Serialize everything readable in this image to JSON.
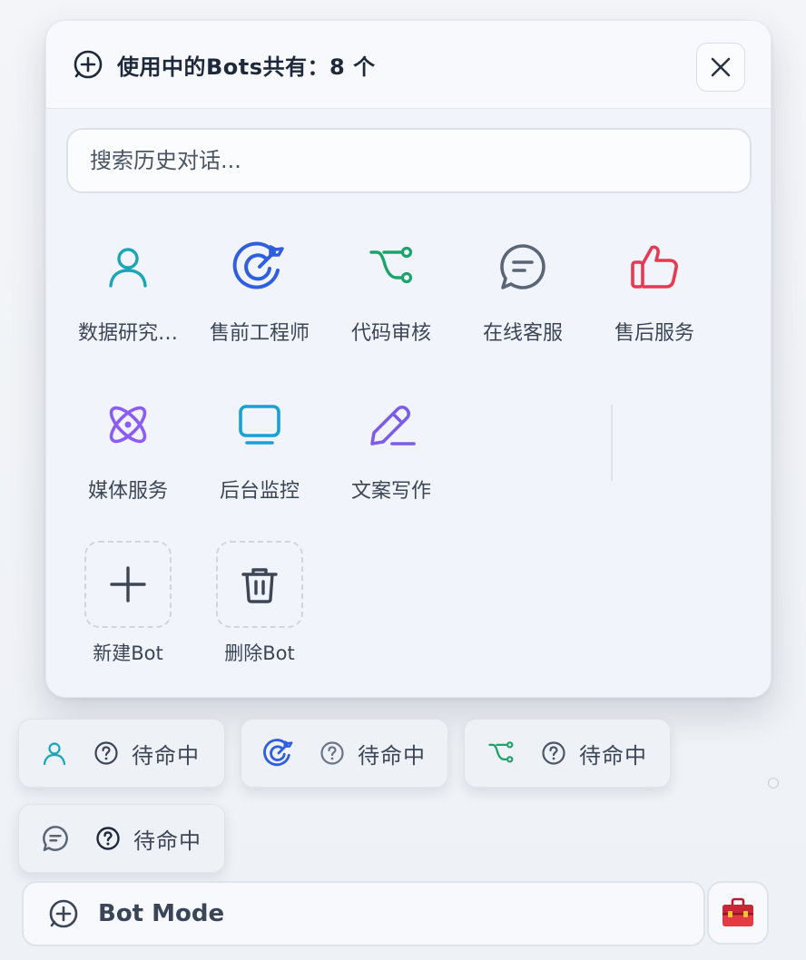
{
  "modal": {
    "title": "使用中的Bots共有：8 个",
    "search_placeholder": "搜索历史对话..."
  },
  "bots": [
    {
      "label": "数据研究…",
      "icon": "user-icon",
      "color": "#1aa6b7"
    },
    {
      "label": "售前工程师",
      "icon": "target-arrow-icon",
      "color": "#2f5fe0"
    },
    {
      "label": "代码审核",
      "icon": "branch-icon",
      "color": "#1ea36b"
    },
    {
      "label": "在线客服",
      "icon": "chat-bubble-icon",
      "color": "#5a6576"
    },
    {
      "label": "售后服务",
      "icon": "thumbs-up-icon",
      "color": "#e63a52"
    },
    {
      "label": "媒体服务",
      "icon": "atom-icon",
      "color": "#8b5cf6"
    },
    {
      "label": "后台监控",
      "icon": "monitor-icon",
      "color": "#1aa0d8"
    },
    {
      "label": "文案写作",
      "icon": "pencil-icon",
      "color": "#7c5ce8"
    }
  ],
  "actions": {
    "new_bot": "新建Bot",
    "delete_bot": "删除Bot"
  },
  "status_chips": [
    {
      "icon": "user-icon",
      "status": "待命中"
    },
    {
      "icon": "target-arrow-icon",
      "status": "待命中"
    },
    {
      "icon": "branch-icon",
      "status": "待命中"
    },
    {
      "icon": "chat-bubble-icon",
      "status": "待命中"
    }
  ],
  "bottom_bar": {
    "mode_label": "Bot Mode"
  }
}
